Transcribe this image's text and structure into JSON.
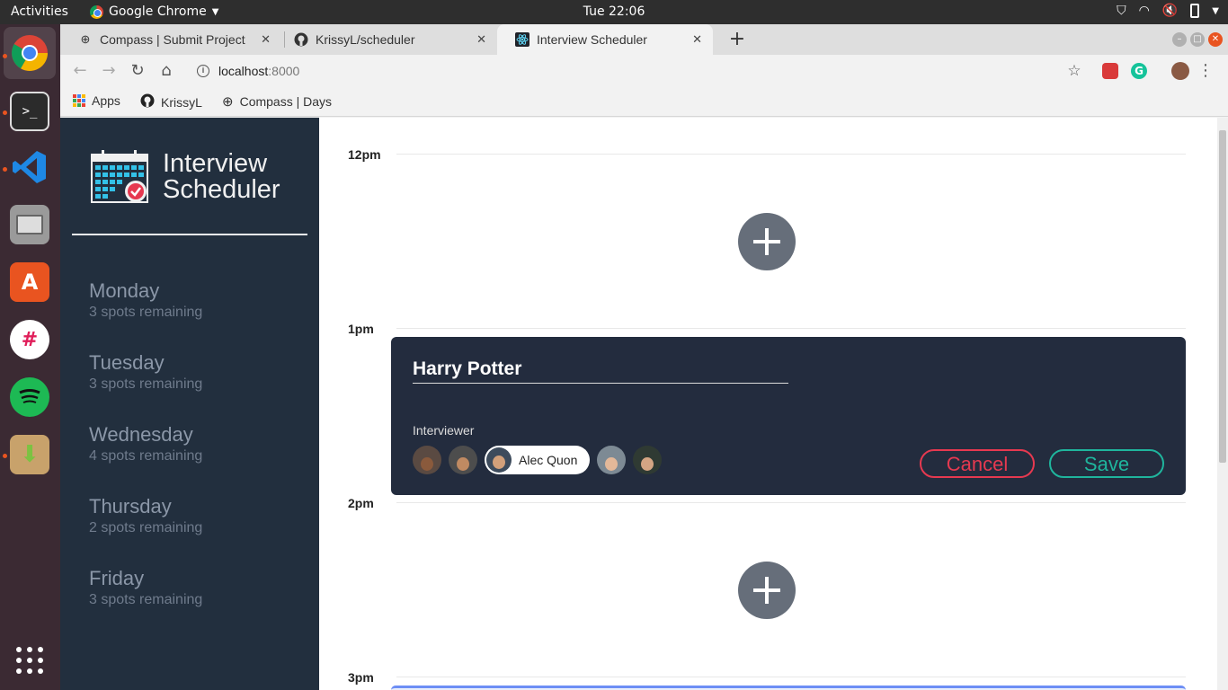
{
  "topbar": {
    "activities": "Activities",
    "app_name": "Google Chrome",
    "clock": "Tue 22:06"
  },
  "browser": {
    "tabs": [
      {
        "title": "Compass | Submit Project",
        "icon": "compass-icon"
      },
      {
        "title": "KrissyL/scheduler",
        "icon": "github-icon"
      },
      {
        "title": "Interview Scheduler",
        "icon": "react-icon",
        "active": true
      }
    ],
    "url_host": "localhost",
    "url_port": ":8000",
    "bookmarks": [
      {
        "label": "Apps",
        "icon": "apps-grid-icon"
      },
      {
        "label": "KrissyL",
        "icon": "github-icon"
      },
      {
        "label": "Compass | Days",
        "icon": "compass-icon"
      }
    ]
  },
  "sidebar": {
    "title_line1": "Interview",
    "title_line2": "Scheduler",
    "days": [
      {
        "name": "Monday",
        "spots": "3 spots remaining"
      },
      {
        "name": "Tuesday",
        "spots": "3 spots remaining"
      },
      {
        "name": "Wednesday",
        "spots": "4 spots remaining"
      },
      {
        "name": "Thursday",
        "spots": "2 spots remaining"
      },
      {
        "name": "Friday",
        "spots": "3 spots remaining"
      }
    ]
  },
  "schedule": {
    "times": [
      "12pm",
      "1pm",
      "2pm",
      "3pm"
    ],
    "form": {
      "student_name": "Harry Potter",
      "interviewer_label": "Interviewer",
      "selected_interviewer": "Alec Quon",
      "cancel_label": "Cancel",
      "save_label": "Save"
    }
  },
  "colors": {
    "sidebar_bg": "#222f3e",
    "card_bg": "#232c3e",
    "cancel": "#e63950",
    "save": "#1fb59d",
    "add_button": "#666e7a"
  }
}
